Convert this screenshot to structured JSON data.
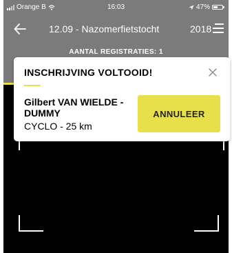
{
  "status_bar": {
    "carrier": "Orange B",
    "time": "16:03",
    "battery": "47%",
    "battery_level": 0.47
  },
  "header": {
    "title": "12.09 - Nazomerfietstocht",
    "year": "2018",
    "registrations": "AANTAL REGISTRATIES: 1"
  },
  "dialog": {
    "title": "INSCHRIJVING VOLTOOID!",
    "name": "Gilbert VAN WIELDE - DUMMY",
    "ride": "CYCLO - 25 km",
    "cancel_label": "ANNULEER"
  },
  "colors": {
    "accent": "#e8e04a",
    "header_bg": "#7b7b7b",
    "camera_bg": "#000000"
  },
  "icons": {
    "back": "arrow-left-icon",
    "menu": "hamburger-menu-icon",
    "close": "close-icon",
    "wifi": "wifi-icon",
    "location": "location-arrow-icon",
    "battery": "battery-icon",
    "signal": "signal-bars-icon"
  }
}
